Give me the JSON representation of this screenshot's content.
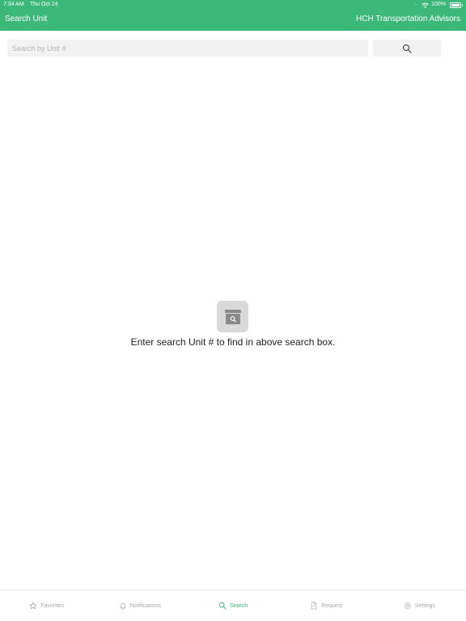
{
  "status_bar": {
    "time": "7:34 AM",
    "date": "Thu Oct 24",
    "battery_percent": "100%",
    "battery_level": 1.0,
    "wifi_icon": "wifi-icon",
    "battery_icon": "battery-icon"
  },
  "header": {
    "title": "Search Unit",
    "company": "HCH Transportation Advisors",
    "background_color": "#3cb878"
  },
  "search": {
    "placeholder": "Search by Unit #",
    "value": "",
    "button_icon": "search-icon"
  },
  "empty_state": {
    "icon": "archive-search-icon",
    "message": "Enter search Unit # to find in above search box."
  },
  "tabbar": {
    "active_color": "#3cb878",
    "items": [
      {
        "label": "Favorites",
        "icon": "star-icon",
        "active": false
      },
      {
        "label": "Notifications",
        "icon": "bell-icon",
        "active": false
      },
      {
        "label": "Search",
        "icon": "search-icon",
        "active": true
      },
      {
        "label": "Request",
        "icon": "document-icon",
        "active": false
      },
      {
        "label": "Settings",
        "icon": "gear-icon",
        "active": false
      }
    ]
  }
}
